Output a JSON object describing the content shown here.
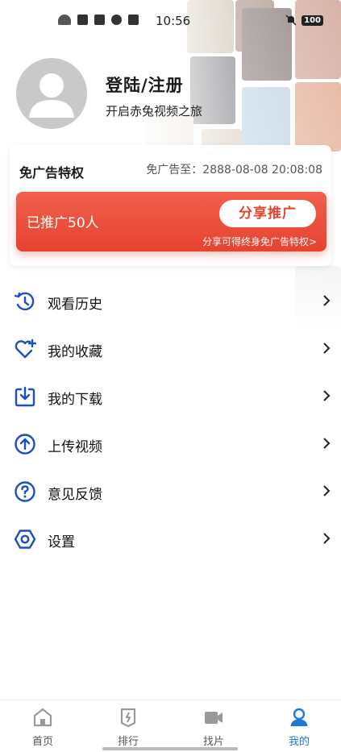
{
  "status_bar": {
    "time": "10:56",
    "battery": "100"
  },
  "profile": {
    "title": "登陆/注册",
    "subtitle": "开启赤兔视频之旅"
  },
  "card": {
    "title": "免广告特权",
    "expire": "免广告至：2888-08-08 20:08:08",
    "promo_count": "已推广50人",
    "share_button": "分享推广",
    "promo_tip": "分享可得终身免广告特权>"
  },
  "menu": [
    {
      "label": "观看历史",
      "icon": "history-icon"
    },
    {
      "label": "我的收藏",
      "icon": "heart-plus-icon"
    },
    {
      "label": "我的下载",
      "icon": "download-icon"
    },
    {
      "label": "上传视频",
      "icon": "upload-icon"
    },
    {
      "label": "意见反馈",
      "icon": "question-icon"
    },
    {
      "label": "设置",
      "icon": "settings-icon"
    }
  ],
  "tabs": [
    {
      "label": "首页",
      "icon": "home-icon"
    },
    {
      "label": "排行",
      "icon": "ranking-icon"
    },
    {
      "label": "找片",
      "icon": "video-camera-icon"
    },
    {
      "label": "我的",
      "icon": "user-icon",
      "active": true
    }
  ],
  "colors": {
    "accent": "#1e78d8",
    "icon_blue": "#1d4fc4",
    "promo_red": "#e6432f"
  }
}
